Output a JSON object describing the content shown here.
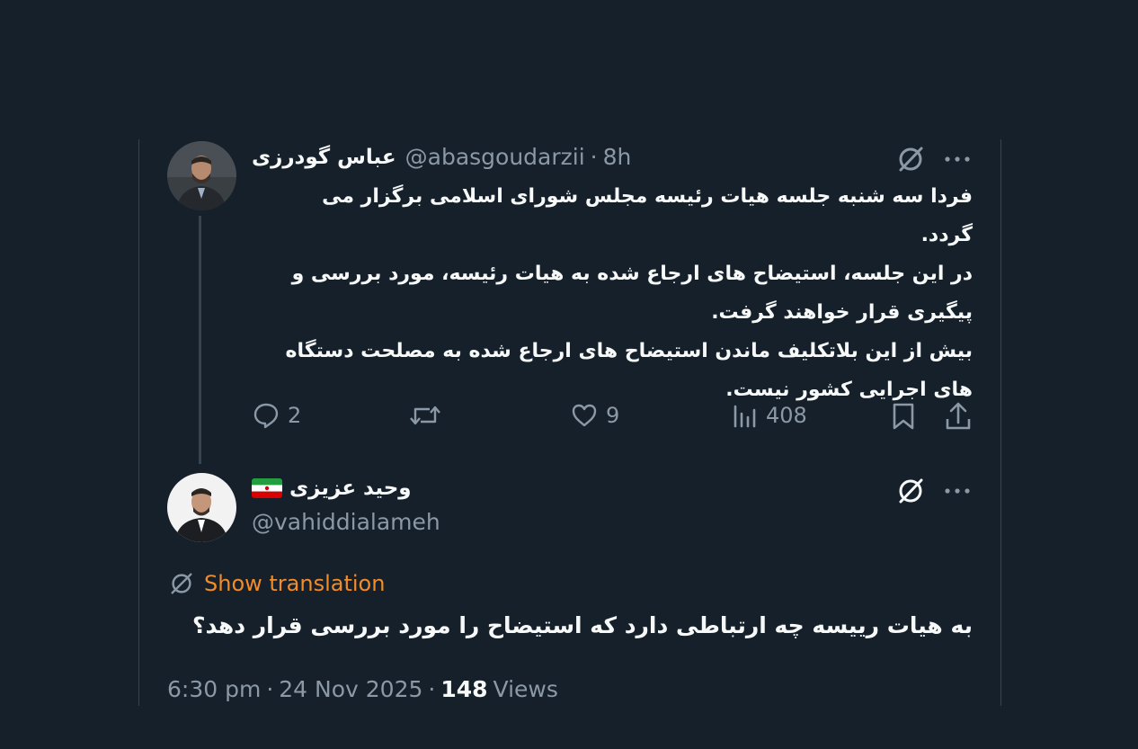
{
  "tweet": {
    "author": {
      "display_name": "عباس گودرزی",
      "handle": "@abasgoudarzii",
      "time_ago": "8h"
    },
    "text": "فردا سه شنبه جلسه هیات رئیسه مجلس شورای اسلامی برگزار می گردد.\nدر این جلسه، استیضاح های ارجاع شده به هیات رئیسه، مورد بررسی و پیگیری قرار خواهند گرفت.\nبیش از این بلاتکلیف ماندن استیضاح های  ارجاع شده به مصلحت دستگاه های اجرایی کشور نیست.",
    "actions": {
      "replies": "2",
      "retweets": "",
      "likes": "9",
      "views": "408"
    }
  },
  "reply": {
    "author": {
      "display_name": "وحید عزیزی",
      "handle": "@vahiddialameh",
      "flag": "iran-flag-icon"
    },
    "translate_label": "Show translation",
    "text": "به هیات رییسه چه ارتباطی دارد که استیضاح را مورد بررسی قرار دهد؟",
    "footer": {
      "time": "6:30 pm",
      "date": "24 Nov 2025",
      "views_count": "148",
      "views_label": "Views"
    }
  },
  "colors": {
    "background": "#15202b",
    "text_primary": "#f7f9f9",
    "text_secondary": "#8b98a5",
    "translate_accent": "#f28c28",
    "border": "#38444d"
  }
}
